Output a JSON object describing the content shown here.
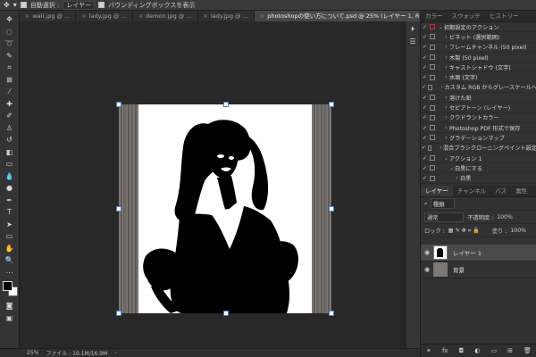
{
  "options_bar": {
    "auto_select_label": "自動選択 :",
    "layer_select": "レイヤー",
    "bounding_box_label": "バウンディングボックスを表示"
  },
  "tabs": [
    {
      "label": "wall.jpg @ ..."
    },
    {
      "label": "lady.jpg @ ..."
    },
    {
      "label": "demon.jpg @ ..."
    },
    {
      "label": "lady.jpg @ ..."
    },
    {
      "label": "photoshopの使い方について.psd @ 25% (レイヤー 1, RGB/8) *"
    }
  ],
  "status": {
    "zoom": "25%",
    "file_info": "ファイル : 10.1M/16.9M"
  },
  "top_panel": {
    "tabs": [
      "カラー",
      "スウォッチ",
      "ヒストリー"
    ],
    "actions": [
      {
        "label": "初期設定のアクション",
        "level": 0,
        "expanded": true
      },
      {
        "label": "ビネット (選択範囲)",
        "level": 1
      },
      {
        "label": "フレームチャンネル (50 pixel)",
        "level": 1
      },
      {
        "label": "木製 (50 pixel)",
        "level": 1
      },
      {
        "label": "キャストシャドウ (文字)",
        "level": 1
      },
      {
        "label": "水面 (文字)",
        "level": 1
      },
      {
        "label": "カスタム RGB からグレースケールへ",
        "level": 1
      },
      {
        "label": "溶けた鉛",
        "level": 1
      },
      {
        "label": "セピアトーン (レイヤー)",
        "level": 1
      },
      {
        "label": "クワドラントカラー",
        "level": 1
      },
      {
        "label": "Photoshop PDF 形式で保存",
        "level": 1
      },
      {
        "label": "グラデーションマップ",
        "level": 1
      },
      {
        "label": "混合ブラシクローニングペイント設定",
        "level": 1
      },
      {
        "label": "アクション 1",
        "level": 1,
        "expanded": true
      },
      {
        "label": "白黒にする",
        "level": 2,
        "expanded": true
      },
      {
        "label": "白黒",
        "level": 3
      }
    ]
  },
  "layers_panel": {
    "tabs": [
      "レイヤー",
      "チャンネル",
      "パス",
      "属性"
    ],
    "kind_label": "種類",
    "blend_mode": "通常",
    "opacity_label": "不透明度 :",
    "opacity_value": "100%",
    "lock_label": "ロック :",
    "fill_label": "塗り :",
    "fill_value": "100%",
    "layers": [
      {
        "name": "レイヤー 1",
        "selected": true
      },
      {
        "name": "背景",
        "selected": false
      }
    ]
  },
  "colors": {
    "accent": "#4d7fd0",
    "bg": "#282828",
    "panel": "#323232"
  }
}
